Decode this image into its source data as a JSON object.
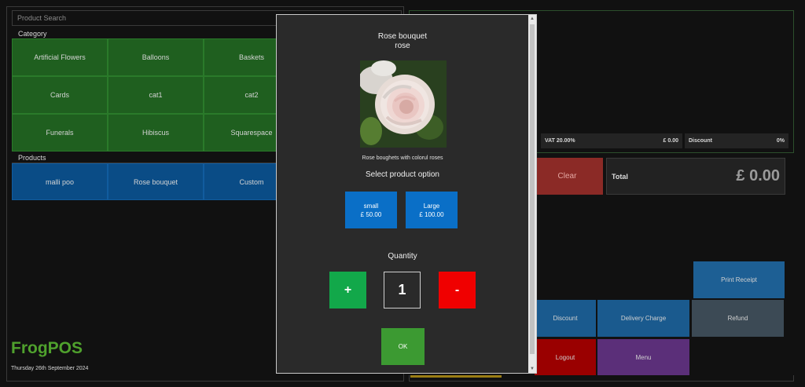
{
  "search": {
    "placeholder": "Product Search"
  },
  "category": {
    "label": "Category",
    "items": [
      "Artificial Flowers",
      "Balloons",
      "Baskets",
      "Cards",
      "cat1",
      "cat2",
      "Funerals",
      "Hibiscus",
      "Squarespace"
    ]
  },
  "products": {
    "label": "Products",
    "items": [
      "malli poo",
      "Rose bouquet",
      "Custom"
    ]
  },
  "brand": {
    "name": "FrogPOS",
    "date": "Thursday 26th September 2024"
  },
  "summary": {
    "vat_label": "VAT 20.00%",
    "vat_value": "£ 0.00",
    "discount_label": "Discount",
    "discount_value": "0%"
  },
  "cart": {
    "clear_label": "Clear",
    "total_label": "Total",
    "total_value": "£ 0.00"
  },
  "actions": {
    "print_receipt": "Print Receipt",
    "discount": "Discount",
    "delivery_charge": "Delivery Charge",
    "refund": "Refund",
    "logout": "Logout",
    "menu": "Menu"
  },
  "modal": {
    "title_line1": "Rose bouquet",
    "title_line2": "rose",
    "description": "Rose boughets with colorul roses",
    "option_heading": "Select product option",
    "options": [
      {
        "name": "small",
        "price": "£ 50.00"
      },
      {
        "name": "Large",
        "price": "£ 100.00"
      }
    ],
    "quantity_heading": "Quantity",
    "plus": "+",
    "minus": "-",
    "quantity": "1",
    "ok": "OK"
  },
  "colors": {
    "category_tile": "#1f5f1f",
    "product_tile": "#0a4c86",
    "brand": "#4fa12d",
    "clear": "#8b2a26",
    "option": "#0a6fc7",
    "plus": "#12a84a",
    "minus": "#f00000",
    "ok": "#3c9a32",
    "print_receipt": "#1d5f94",
    "discount": "#1a5a8e",
    "delivery_charge": "#1a5a8e",
    "refund": "#3c4a55",
    "logout": "#9a0000",
    "menu": "#5b2f79"
  },
  "icons": {
    "scroll_up": "triangle-up-icon",
    "scroll_down": "triangle-down-icon"
  }
}
